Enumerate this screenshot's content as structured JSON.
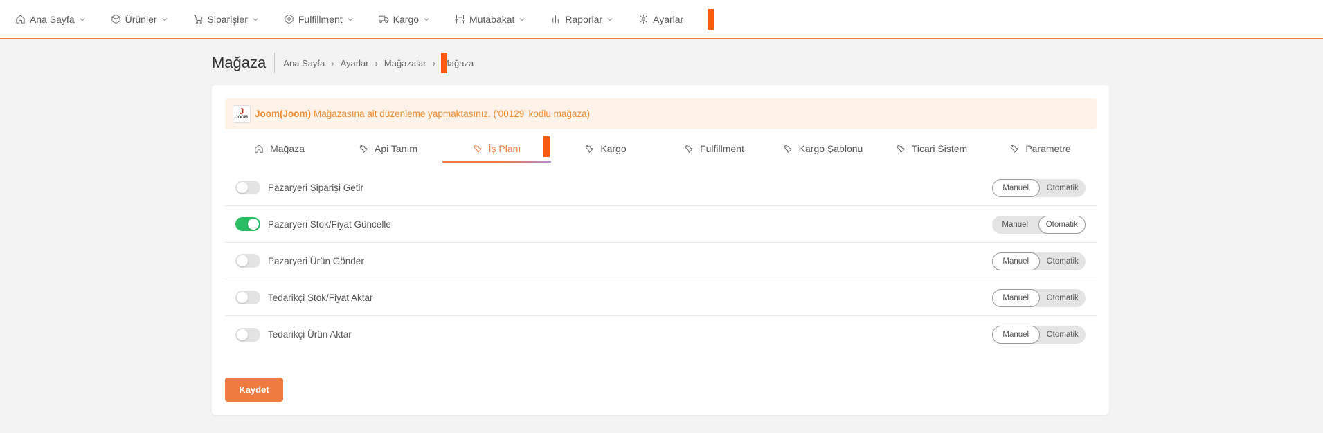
{
  "nav": {
    "items": [
      {
        "label": "Ana Sayfa",
        "icon": "home-icon"
      },
      {
        "label": "Ürünler",
        "icon": "box-icon"
      },
      {
        "label": "Siparişler",
        "icon": "cart-icon"
      },
      {
        "label": "Fulfillment",
        "icon": "hexagon-icon"
      },
      {
        "label": "Kargo",
        "icon": "truck-icon"
      },
      {
        "label": "Mutabakat",
        "icon": "sliders-icon"
      },
      {
        "label": "Raporlar",
        "icon": "bar-chart-icon"
      },
      {
        "label": "Ayarlar",
        "icon": "gear-icon"
      }
    ]
  },
  "page": {
    "title": "Mağaza",
    "breadcrumb": [
      "Ana Sayfa",
      "Ayarlar",
      "Mağazalar",
      "Mağaza"
    ]
  },
  "alert": {
    "logo_letter": "J",
    "logo_text": "JOOM",
    "store_name": "Joom(Joom)",
    "message": "Mağazasına ait düzenleme yapmaktasınız. ('00129' kodlu mağaza)"
  },
  "tabs": [
    {
      "label": "Mağaza",
      "icon": "home-icon",
      "active": false
    },
    {
      "label": "Api Tanım",
      "icon": "wrench-icon",
      "active": false
    },
    {
      "label": "İş Planı",
      "icon": "wrench-icon",
      "active": true
    },
    {
      "label": "Kargo",
      "icon": "wrench-icon",
      "active": false
    },
    {
      "label": "Fulfillment",
      "icon": "wrench-icon",
      "active": false
    },
    {
      "label": "Kargo Şablonu",
      "icon": "wrench-icon",
      "active": false
    },
    {
      "label": "Ticari Sistem",
      "icon": "wrench-icon",
      "active": false
    },
    {
      "label": "Parametre",
      "icon": "wrench-icon",
      "active": false
    }
  ],
  "jobs": [
    {
      "label": "Pazaryeri Siparişi Getir",
      "enabled": false,
      "mode": "Manuel"
    },
    {
      "label": "Pazaryeri Stok/Fiyat Güncelle",
      "enabled": true,
      "mode": "Otomatik"
    },
    {
      "label": "Pazaryeri Ürün Gönder",
      "enabled": false,
      "mode": "Manuel"
    },
    {
      "label": "Tedarikçi Stok/Fiyat Aktar",
      "enabled": false,
      "mode": "Manuel"
    },
    {
      "label": "Tedarikçi Ürün Aktar",
      "enabled": false,
      "mode": "Manuel"
    }
  ],
  "mode_options": [
    "Manuel",
    "Otomatik"
  ],
  "save_label": "Kaydet",
  "colors": {
    "accent": "#f07b40",
    "toggle_on": "#2bbd63",
    "marker": "#ff5a10"
  }
}
